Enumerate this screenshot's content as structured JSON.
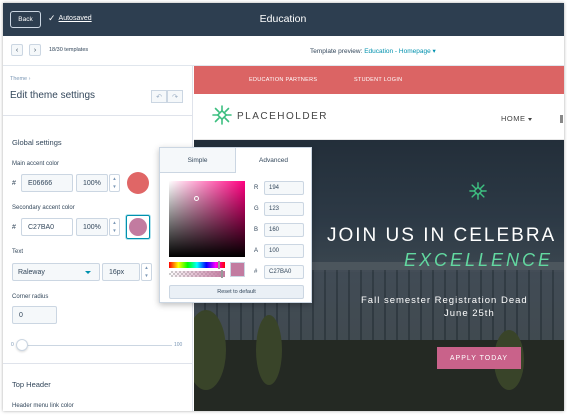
{
  "topbar": {
    "back_label": "Back",
    "autosaved_label": "Autosaved",
    "title": "Education"
  },
  "subbar": {
    "prev_icon": "‹",
    "next_icon": "›",
    "template_count": "18/30 templates",
    "preview_prefix": "Template preview:",
    "preview_name": "Education - Homepage",
    "preview_caret": "▾"
  },
  "panel": {
    "breadcrumb": "Theme ›",
    "title": "Edit theme settings",
    "undo_icon": "↶",
    "redo_icon": "↷",
    "global_settings": {
      "title": "Global settings",
      "main_accent": {
        "label": "Main accent color",
        "hash": "#",
        "hex": "E06666",
        "opacity": "100%",
        "color": "#e06666"
      },
      "secondary_accent": {
        "label": "Secondary accent color",
        "hash": "#",
        "hex": "C27BA0",
        "opacity": "100%",
        "color": "#c27ba0"
      },
      "text": {
        "label": "Text",
        "font": "Raleway",
        "size": "16px",
        "color": "#db5a5a"
      },
      "corner_radius": {
        "label": "Corner radius",
        "value": "0",
        "slider_value": 0,
        "min": "0",
        "max": "100"
      }
    },
    "top_header": {
      "title": "Top Header",
      "link_color_label": "Header menu link color"
    }
  },
  "picker": {
    "tab_simple": "Simple",
    "tab_advanced": "Advanced",
    "r_label": "R",
    "r": "194",
    "g_label": "G",
    "g": "123",
    "b_label": "B",
    "b": "160",
    "a_label": "A",
    "a": "100",
    "hex_label": "#",
    "hex": "C27BA0",
    "reset_label": "Reset to default",
    "selected_color": "#c27ba0"
  },
  "site_preview": {
    "top_links": [
      "EDUCATION PARTNERS",
      "STUDENT LOGIN"
    ],
    "logo_text": "PLACEHOLDER",
    "nav_home": "HOME",
    "hero_line1": "JOIN US IN CELEBRA",
    "hero_line2": "EXCELLENCE",
    "hero_text1": "Fall semester Registration Dead",
    "hero_text2": "June 25th",
    "cta_label": "APPLY TODAY",
    "accent_color": "#db6464",
    "highlight_color": "#62d8a0",
    "button_color": "#c9628a"
  }
}
